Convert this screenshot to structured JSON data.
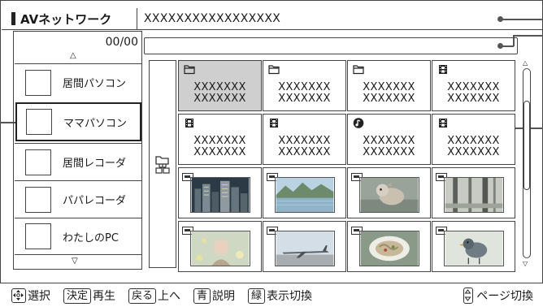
{
  "header": {
    "title": "AVネットワーク",
    "path": "XXXXXXXXXXXXXXXXX"
  },
  "sidebar": {
    "counter": "00/00",
    "devices": [
      {
        "label": "居間パソコン",
        "selected": false
      },
      {
        "label": "ママパソコン",
        "selected": true
      },
      {
        "label": "居間レコーダ",
        "selected": false
      },
      {
        "label": "パパレコーダ",
        "selected": false
      },
      {
        "label": "わたしのPC",
        "selected": false
      }
    ]
  },
  "grid": {
    "row1": [
      {
        "icon": "folder-icon",
        "line1": "XXXXXXX",
        "line2": "XXXXXXX",
        "selected": true
      },
      {
        "icon": "folder-icon",
        "line1": "XXXXXXX",
        "line2": "XXXXXXX",
        "selected": false
      },
      {
        "icon": "folder-icon",
        "line1": "XXXXXXX",
        "line2": "XXXXXXX",
        "selected": false
      },
      {
        "icon": "film-icon",
        "line1": "XXXXXXX",
        "line2": "XXXXXXX",
        "selected": false
      }
    ],
    "row2": [
      {
        "icon": "film-icon",
        "line1": "XXXXXXX",
        "line2": "XXXXXXX"
      },
      {
        "icon": "film-icon",
        "line1": "XXXXXXX",
        "line2": "XXXXXXX"
      },
      {
        "icon": "music-icon",
        "line1": "XXXXXXX",
        "line2": "XXXXXXX"
      },
      {
        "icon": "film-icon",
        "line1": "XXXXXXX",
        "line2": "XXXXXXX"
      }
    ],
    "photos": [
      "city-night-photo",
      "lake-mountain-photo",
      "dog-photo",
      "forest-photo",
      "child-flowers-photo",
      "airplane-photo",
      "food-plate-photo",
      "bird-photo"
    ]
  },
  "footer": {
    "select_label": "選択",
    "enter_key": "決定",
    "enter_label": "再生",
    "back_key": "戻る",
    "back_label": "上へ",
    "blue_key": "青",
    "blue_label": "説明",
    "green_key": "緑",
    "green_label": "表示切換",
    "page_label": "ページ切換"
  }
}
